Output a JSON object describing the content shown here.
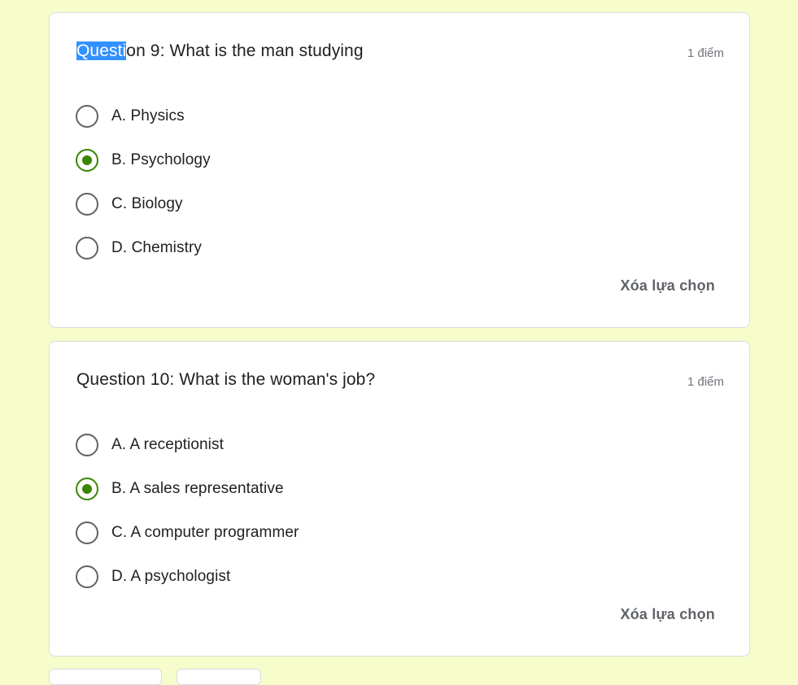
{
  "questions": [
    {
      "title_highlight": "Questi",
      "title_rest": "on 9: What is the man studying",
      "points": "1 điểm",
      "options": [
        {
          "label": "A. Physics",
          "selected": false
        },
        {
          "label": "B. Psychology",
          "selected": true
        },
        {
          "label": "C. Biology",
          "selected": false
        },
        {
          "label": "D. Chemistry",
          "selected": false
        }
      ],
      "clear_label": "Xóa lựa chọn"
    },
    {
      "title": "Question 10: What is the woman's job?",
      "points": "1 điểm",
      "options": [
        {
          "label": "A. A receptionist",
          "selected": false
        },
        {
          "label": "B. A sales representative",
          "selected": true
        },
        {
          "label": "C. A computer programmer",
          "selected": false
        },
        {
          "label": "D. A psychologist",
          "selected": false
        }
      ],
      "clear_label": "Xóa lựa chọn"
    }
  ],
  "colors": {
    "page_background": "#f6fcca",
    "accent_green": "#3b8600",
    "selection_highlight": "#3390ff"
  },
  "icons": {
    "radio_unchecked": "radio-unchecked-icon",
    "radio_checked": "radio-checked-icon"
  }
}
